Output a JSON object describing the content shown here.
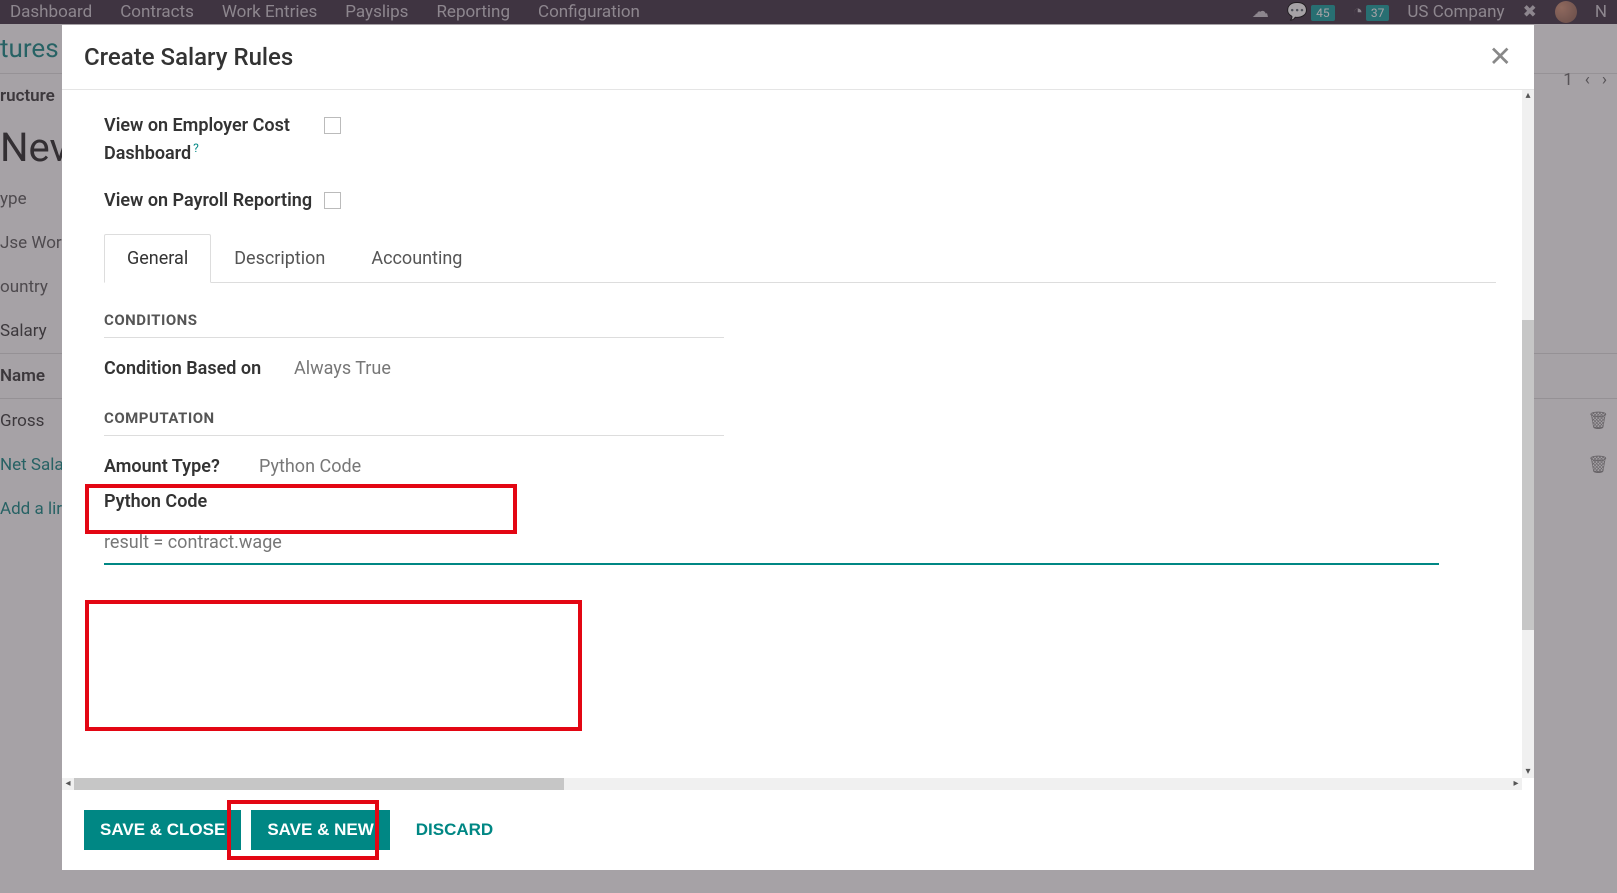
{
  "bg": {
    "nav": [
      "Dashboard",
      "Contracts",
      "Work Entries",
      "Payslips",
      "Reporting",
      "Configuration"
    ],
    "badge1": "45",
    "badge2": "37",
    "company": "US Company",
    "secondary": "tures",
    "pager": "1",
    "left_labels": [
      "ructure",
      "ype",
      "Jse Wor",
      "ountry"
    ],
    "new": "Nev",
    "tab": "Salary",
    "col_name": "Name",
    "rows": [
      "Gross",
      "Net Sala",
      "Add a lir"
    ]
  },
  "modal": {
    "title": "Create Salary Rules",
    "fields": {
      "employer_cost": "View on Employer Cost Dashboard",
      "payroll_reporting": "View on Payroll Reporting"
    },
    "tabs": [
      "General",
      "Description",
      "Accounting"
    ],
    "sections": {
      "conditions": "CONDITIONS",
      "computation": "COMPUTATION"
    },
    "condition": {
      "label": "Condition Based on",
      "value": "Always True"
    },
    "amount": {
      "label": "Amount Type",
      "value": "Python Code"
    },
    "python": {
      "label": "Python Code",
      "code": "result = contract.wage"
    },
    "footer": {
      "save_close": "SAVE & CLOSE",
      "save_new": "SAVE & NEW",
      "discard": "DISCARD"
    }
  }
}
